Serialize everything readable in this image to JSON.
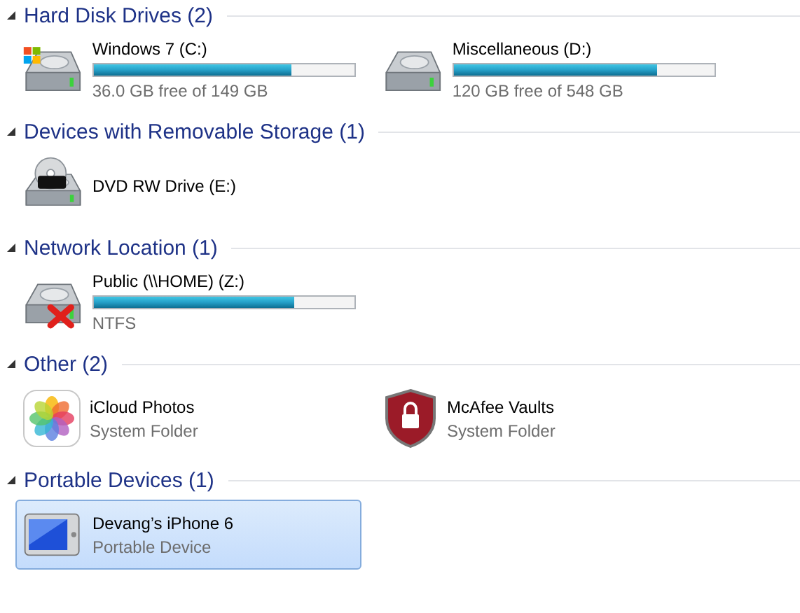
{
  "groups": [
    {
      "title": "Hard Disk Drives (2)",
      "expanded": true,
      "items": [
        {
          "kind": "system-drive",
          "name": "Windows 7 (C:)",
          "level": 0.76,
          "caption": "36.0 GB free of 149 GB",
          "selected": false
        },
        {
          "kind": "drive",
          "name": "Miscellaneous (D:)",
          "level": 0.78,
          "caption": "120 GB free of 548 GB",
          "selected": false
        }
      ]
    },
    {
      "title": "Devices with Removable Storage (1)",
      "expanded": true,
      "items": [
        {
          "kind": "dvd-drive",
          "name": "DVD RW Drive (E:)",
          "selected": false
        }
      ]
    },
    {
      "title": "Network Location (1)",
      "expanded": true,
      "items": [
        {
          "kind": "network-drive",
          "name": "Public (\\\\HOME) (Z:)",
          "level": 0.77,
          "caption": "NTFS",
          "selected": false
        }
      ]
    },
    {
      "title": "Other (2)",
      "expanded": true,
      "items": [
        {
          "kind": "photos-folder",
          "name": "iCloud Photos",
          "caption": "System Folder",
          "selected": false
        },
        {
          "kind": "vault-folder",
          "name": "McAfee Vaults",
          "caption": "System Folder",
          "selected": false
        }
      ]
    },
    {
      "title": "Portable Devices (1)",
      "expanded": true,
      "items": [
        {
          "kind": "portable-device",
          "name": "Devang’s iPhone 6",
          "caption": "Portable Device",
          "selected": true
        }
      ]
    }
  ]
}
